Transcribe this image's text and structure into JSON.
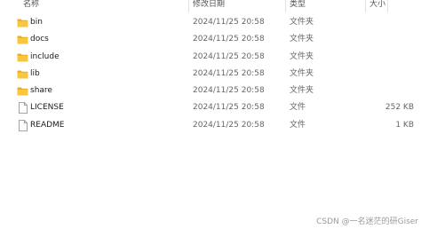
{
  "columns": {
    "name": "名称",
    "date": "修改日期",
    "type": "类型",
    "size": "大小"
  },
  "rows": [
    {
      "name": "bin",
      "date": "2024/11/25 20:58",
      "type": "文件夹",
      "size": "",
      "icon": "folder-icon"
    },
    {
      "name": "docs",
      "date": "2024/11/25 20:58",
      "type": "文件夹",
      "size": "",
      "icon": "folder-icon"
    },
    {
      "name": "include",
      "date": "2024/11/25 20:58",
      "type": "文件夹",
      "size": "",
      "icon": "folder-icon"
    },
    {
      "name": "lib",
      "date": "2024/11/25 20:58",
      "type": "文件夹",
      "size": "",
      "icon": "folder-icon"
    },
    {
      "name": "share",
      "date": "2024/11/25 20:58",
      "type": "文件夹",
      "size": "",
      "icon": "folder-icon"
    },
    {
      "name": "LICENSE",
      "date": "2024/11/25 20:58",
      "type": "文件",
      "size": "252 KB",
      "icon": "file-icon"
    },
    {
      "name": "README",
      "date": "2024/11/25 20:58",
      "type": "文件",
      "size": "1 KB",
      "icon": "file-icon"
    }
  ],
  "watermark": "CSDN @一名迷茫的研Giser",
  "colors": {
    "folder": "#f8c73f",
    "folder_dark": "#e9ad1b",
    "file_border": "#8a8a8a"
  }
}
